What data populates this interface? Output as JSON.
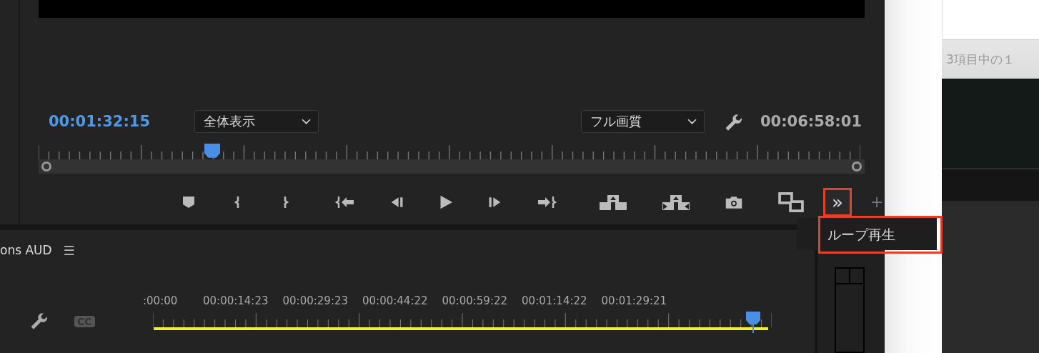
{
  "program_monitor": {
    "current_time": "00:01:32:15",
    "zoom_dropdown": "全体表示",
    "quality_dropdown": "フル画質",
    "duration": "00:06:58:01",
    "playhead": {
      "level": 0.21
    },
    "overflow_button": {
      "label": "»",
      "highlighted": true
    },
    "tooltip": {
      "text": "ループ再生",
      "highlighted": true
    }
  },
  "timeline": {
    "title": "ons AUD",
    "menu_icon": "☰",
    "cc_label": "CC",
    "time_labels": [
      ":00:00",
      "00:00:14:23",
      "00:00:29:23",
      "00:00:44:22",
      "00:00:59:22",
      "00:01:14:22",
      "00:01:29:21"
    ],
    "playhead": {
      "level": 0.97
    }
  },
  "side_window": {
    "status": "3項目中の１"
  }
}
